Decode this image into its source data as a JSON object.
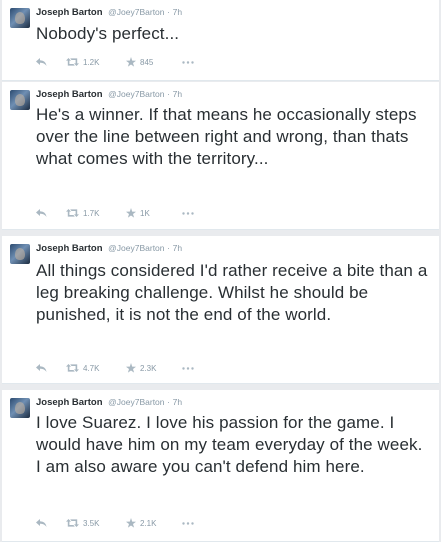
{
  "tweets": [
    {
      "fullname": "Joseph Barton",
      "handle": "@Joey7Barton",
      "separator": "·",
      "time": "7h",
      "text": "Nobody's perfect...",
      "retweets": "1.2K",
      "favorites": "845"
    },
    {
      "fullname": "Joseph Barton",
      "handle": "@Joey7Barton",
      "separator": "·",
      "time": "7h",
      "text": "He's a winner. If that means he occasionally steps over the line between right and wrong, than thats what comes with the territory...",
      "retweets": "1.7K",
      "favorites": "1K"
    },
    {
      "fullname": "Joseph Barton",
      "handle": "@Joey7Barton",
      "separator": "·",
      "time": "7h",
      "text": "All things considered I'd rather receive a bite than a leg breaking challenge. Whilst he should be punished, it is not the end of the world.",
      "retweets": "4.7K",
      "favorites": "2.3K"
    },
    {
      "fullname": "Joseph Barton",
      "handle": "@Joey7Barton",
      "separator": "·",
      "time": "7h",
      "text": "I love Suarez. I love his passion for the game. I would have him on my team everyday of the week. I am also aware you can't defend him here.",
      "retweets": "3.5K",
      "favorites": "2.1K"
    }
  ],
  "icons": {
    "reply": "reply-icon",
    "retweet": "retweet-icon",
    "favorite": "star-icon",
    "more": "more-dots-icon"
  },
  "colors": {
    "name": "#292f33",
    "meta": "#8899a6",
    "icon": "#aab8c2",
    "card": "#ffffff",
    "background": "#e9ebee"
  }
}
